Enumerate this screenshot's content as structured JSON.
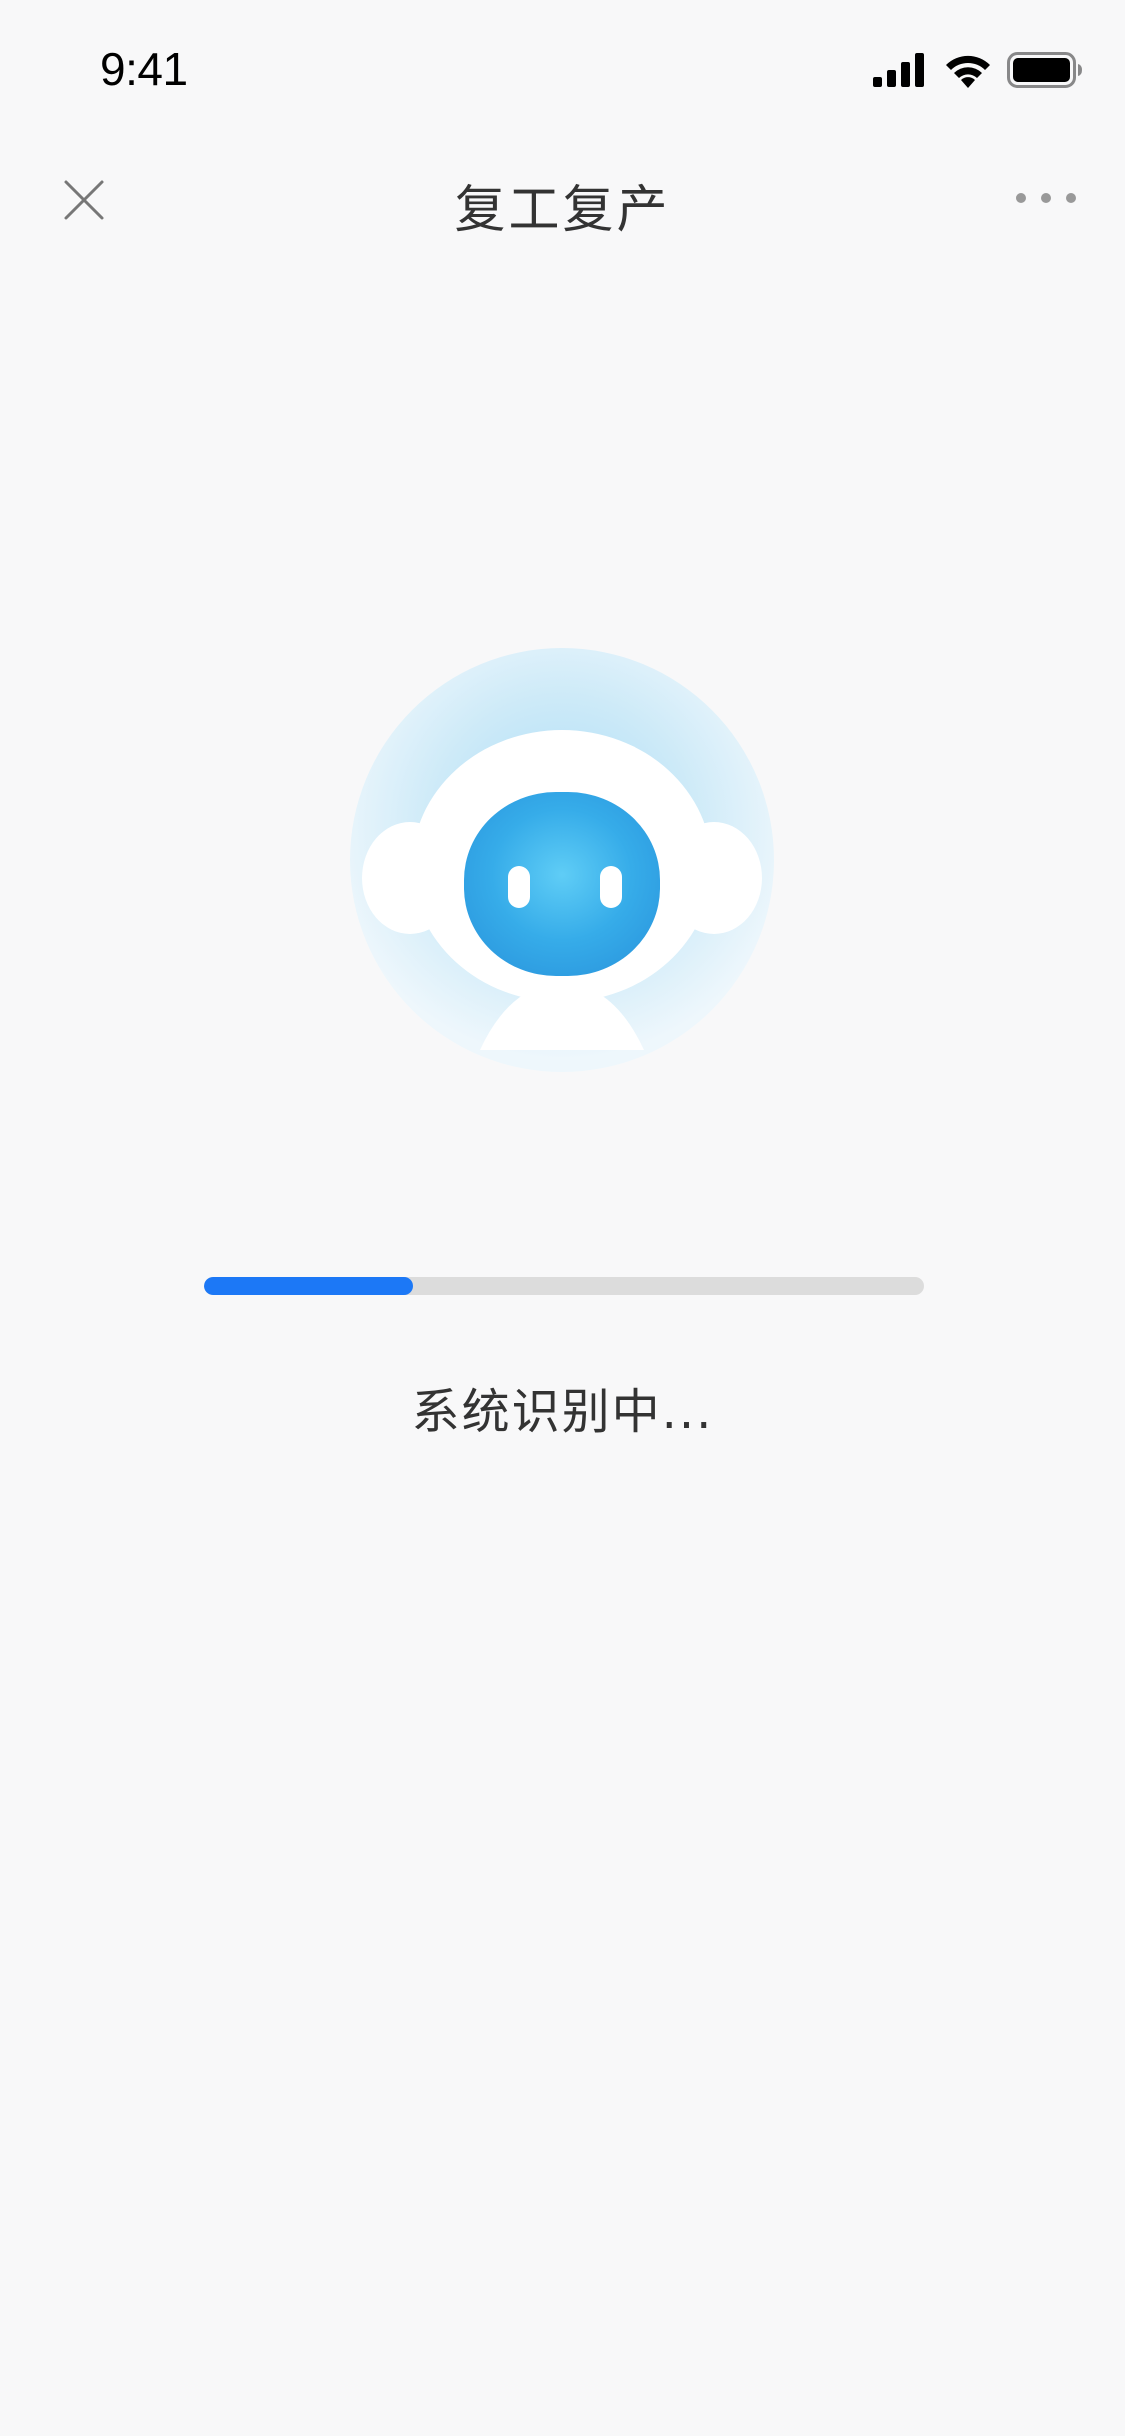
{
  "status_bar": {
    "time": "9:41",
    "signal_icon": "cellular-signal-icon",
    "wifi_icon": "wifi-icon",
    "battery_icon": "battery-icon"
  },
  "nav": {
    "close_icon": "close-icon",
    "title": "复工复产",
    "more_icon": "more-dots-icon"
  },
  "illustration": {
    "icon": "robot-assistant-icon"
  },
  "progress": {
    "percent": 29,
    "fill_color": "#1c78f6",
    "track_color": "#dcdcdc"
  },
  "status_message": "系统识别中..."
}
